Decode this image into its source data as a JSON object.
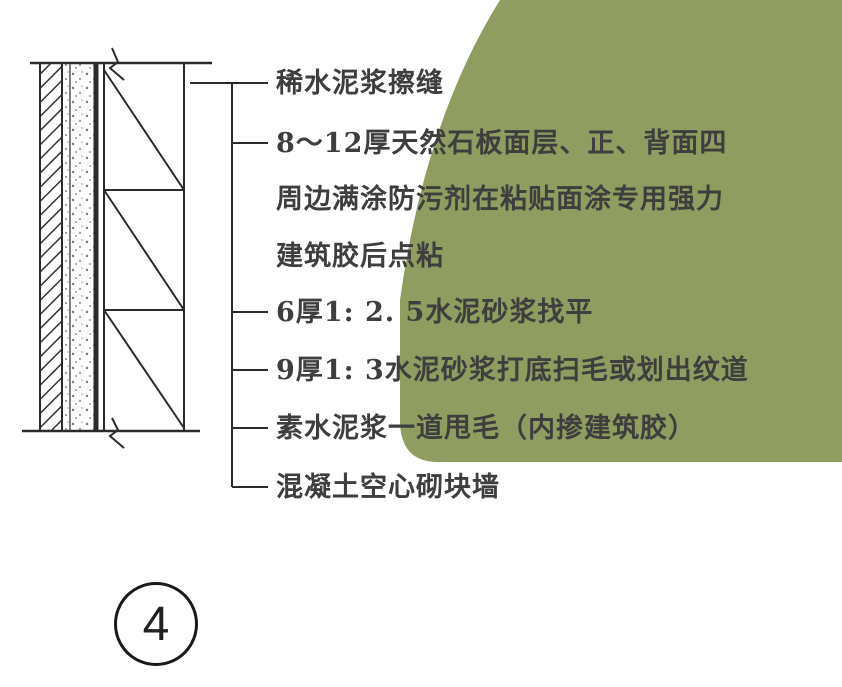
{
  "diagram": {
    "layer_labels": [
      "稀水泥浆擦缝",
      "8～12厚天然石板面层、正、背面四",
      "周边满涂防污剂在粘贴面涂专用强力",
      "建筑胶后点粘",
      "6厚1: 2. 5水泥砂浆找平",
      "9厚1: 3水泥砂浆打底扫毛或划出纹道",
      "素水泥浆一道甩毛（内掺建筑胶）",
      "混凝土空心砌块墙"
    ],
    "detail_number": "4",
    "colors": {
      "line": "#2b2b2b",
      "text": "#3e3e3e",
      "overlay": "#8b9a5b",
      "hatch": "#333333"
    }
  }
}
